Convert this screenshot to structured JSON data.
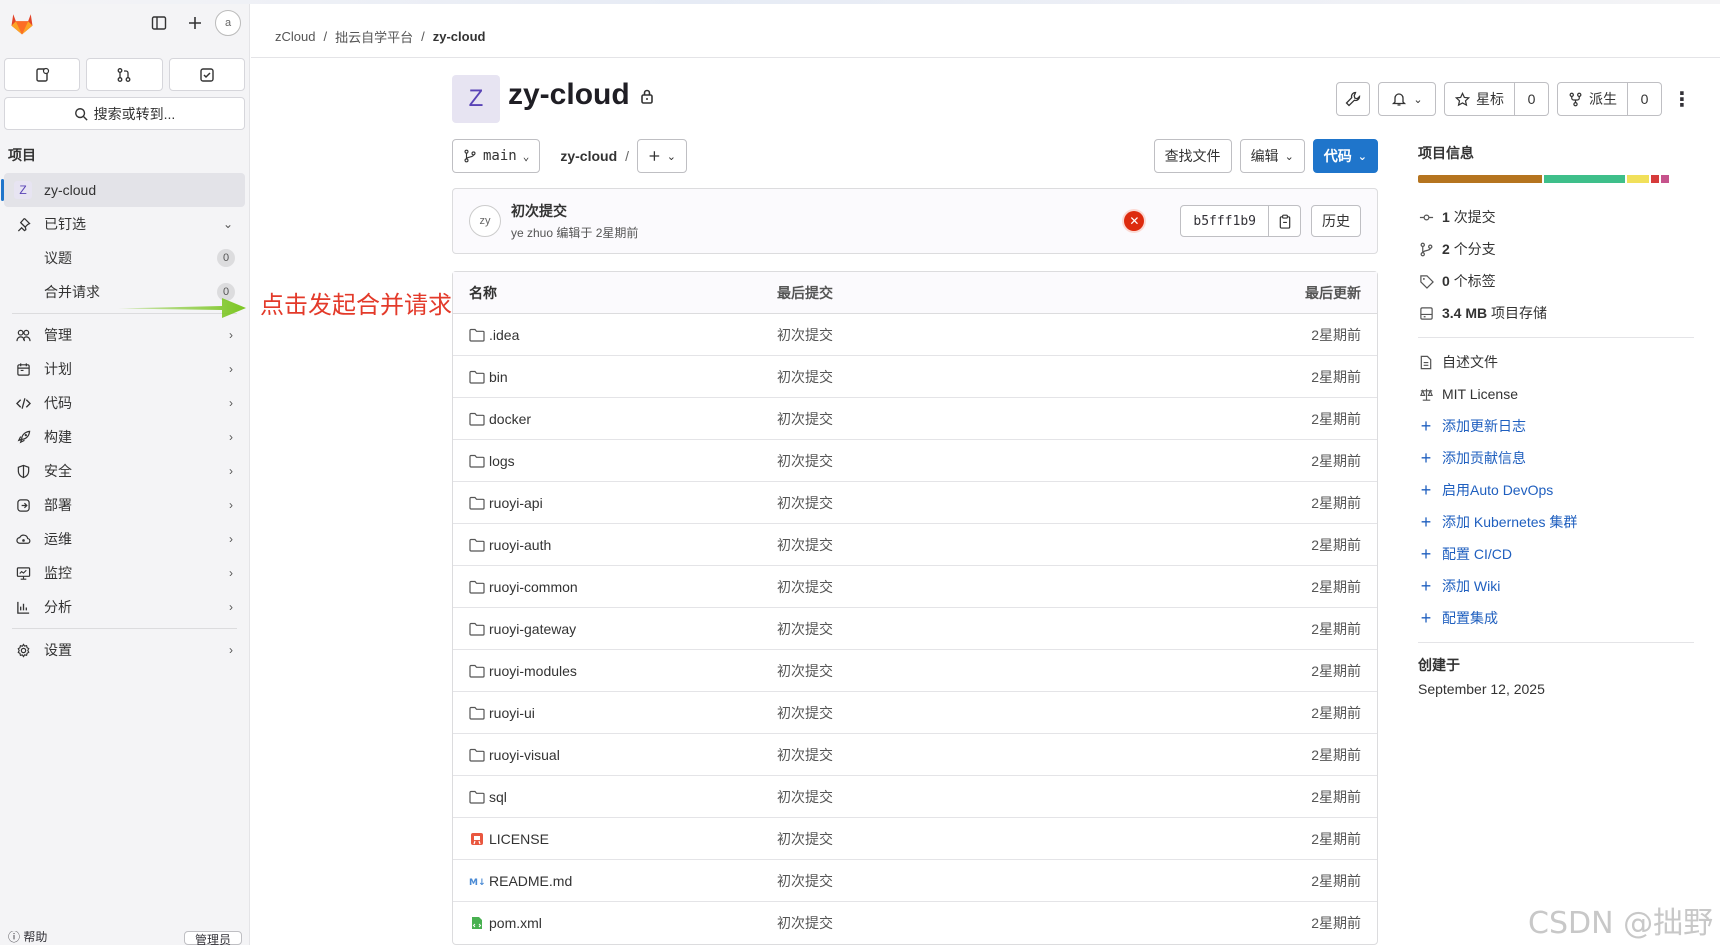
{
  "sidebar": {
    "search_placeholder": "搜索或转到...",
    "section_label": "项目",
    "project_item": "zy-cloud",
    "project_badge": "Z",
    "pinned": {
      "label": "已钉选",
      "items": [
        {
          "label": "议题",
          "count": "0"
        },
        {
          "label": "合并请求",
          "count": "0"
        }
      ]
    },
    "nav": [
      {
        "label": "管理",
        "icon": "users-icon"
      },
      {
        "label": "计划",
        "icon": "calendar-icon"
      },
      {
        "label": "代码",
        "icon": "code-icon"
      },
      {
        "label": "构建",
        "icon": "rocket-icon"
      },
      {
        "label": "安全",
        "icon": "shield-icon"
      },
      {
        "label": "部署",
        "icon": "deploy-icon"
      },
      {
        "label": "运维",
        "icon": "monitor-cloud-icon"
      },
      {
        "label": "监控",
        "icon": "monitor-icon"
      },
      {
        "label": "分析",
        "icon": "chart-icon"
      }
    ],
    "settings": "设置",
    "footer_help": "帮助",
    "footer_admin": "管理员",
    "avatar_alt": "a"
  },
  "annotation": {
    "text": "点击发起合并请求",
    "arrow_color": "#7cc623",
    "text_color": "#e33a2a"
  },
  "breadcrumb": [
    "zCloud",
    "拙云自学平台",
    "zy-cloud"
  ],
  "project": {
    "avatar_letter": "Z",
    "title": "zy-cloud",
    "star_label": "星标",
    "star_count": "0",
    "fork_label": "派生",
    "fork_count": "0"
  },
  "repo_bar": {
    "branch": "main",
    "path": "zy-cloud",
    "slash": "/",
    "find_file": "查找文件",
    "edit": "编辑",
    "code": "代码"
  },
  "commit": {
    "avatar_alt": "zy",
    "title": "初次提交",
    "meta": "ye zhuo 编辑于 2星期前",
    "sha": "b5fff1b9",
    "history": "历史"
  },
  "file_table": {
    "headers": {
      "name": "名称",
      "last_commit": "最后提交",
      "last_update": "最后更新"
    },
    "rows": [
      {
        "name": ".idea",
        "type": "folder",
        "commit": "初次提交",
        "date": "2星期前"
      },
      {
        "name": "bin",
        "type": "folder",
        "commit": "初次提交",
        "date": "2星期前"
      },
      {
        "name": "docker",
        "type": "folder",
        "commit": "初次提交",
        "date": "2星期前"
      },
      {
        "name": "logs",
        "type": "folder",
        "commit": "初次提交",
        "date": "2星期前"
      },
      {
        "name": "ruoyi-api",
        "type": "folder",
        "commit": "初次提交",
        "date": "2星期前"
      },
      {
        "name": "ruoyi-auth",
        "type": "folder",
        "commit": "初次提交",
        "date": "2星期前"
      },
      {
        "name": "ruoyi-common",
        "type": "folder",
        "commit": "初次提交",
        "date": "2星期前"
      },
      {
        "name": "ruoyi-gateway",
        "type": "folder",
        "commit": "初次提交",
        "date": "2星期前"
      },
      {
        "name": "ruoyi-modules",
        "type": "folder",
        "commit": "初次提交",
        "date": "2星期前"
      },
      {
        "name": "ruoyi-ui",
        "type": "folder",
        "commit": "初次提交",
        "date": "2星期前"
      },
      {
        "name": "ruoyi-visual",
        "type": "folder",
        "commit": "初次提交",
        "date": "2星期前"
      },
      {
        "name": "sql",
        "type": "folder",
        "commit": "初次提交",
        "date": "2星期前"
      },
      {
        "name": "LICENSE",
        "type": "license",
        "commit": "初次提交",
        "date": "2星期前"
      },
      {
        "name": "README.md",
        "type": "markdown",
        "commit": "初次提交",
        "date": "2星期前"
      },
      {
        "name": "pom.xml",
        "type": "xml",
        "commit": "初次提交",
        "date": "2星期前"
      }
    ]
  },
  "right_panel": {
    "title": "项目信息",
    "language_colors": [
      "#b5741f",
      "#3ebf8a",
      "#f1e05a",
      "#d73b3b",
      "#c6538c"
    ],
    "stats": [
      {
        "value": "1",
        "label": "次提交",
        "icon": "commit-icon"
      },
      {
        "value": "2",
        "label": "个分支",
        "icon": "branch-icon"
      },
      {
        "value": "0",
        "label": "个标签",
        "icon": "tag-icon"
      },
      {
        "value": "3.4 MB",
        "label": "项目存储",
        "icon": "disk-icon"
      }
    ],
    "readme": "自述文件",
    "license": "MIT License",
    "links": [
      "添加更新日志",
      "添加贡献信息",
      "启用Auto DevOps",
      "添加 Kubernetes 集群",
      "配置 CI/CD",
      "添加 Wiki",
      "配置集成"
    ],
    "created_label": "创建于",
    "created_date": "September 12, 2025"
  },
  "watermark": "CSDN @拙野"
}
